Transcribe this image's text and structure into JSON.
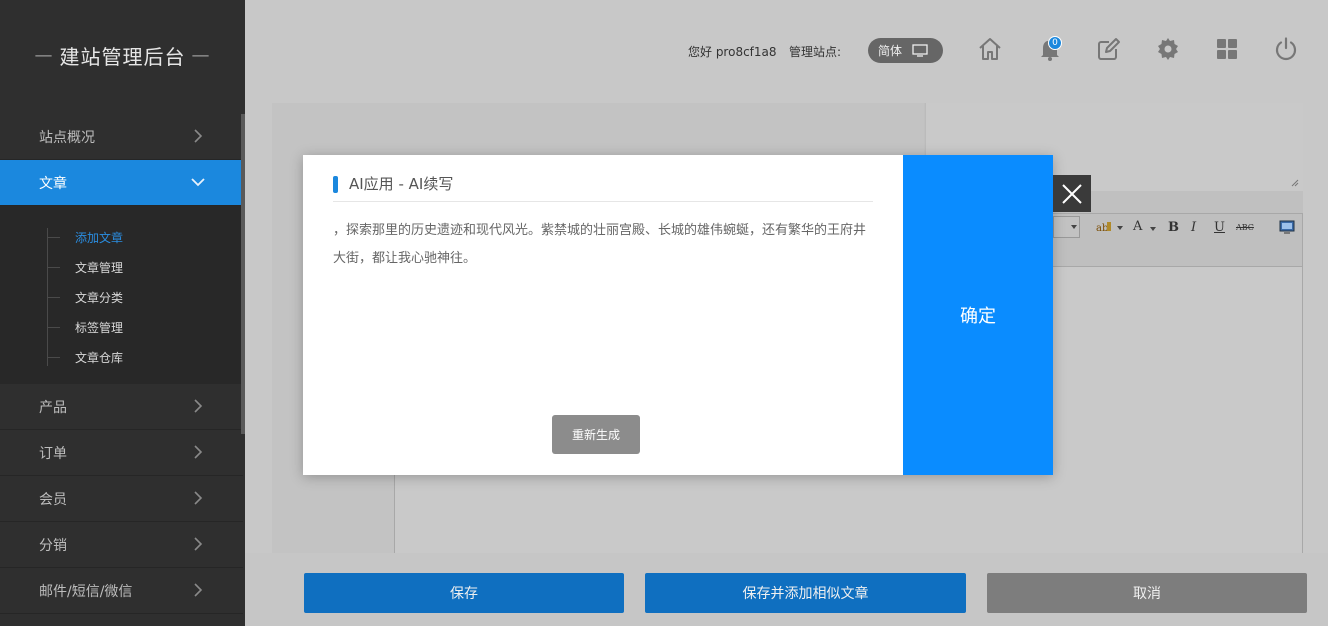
{
  "brand": {
    "title": "建站管理后台"
  },
  "sidebar": {
    "items": [
      {
        "label": "站点概况"
      },
      {
        "label": "文章"
      },
      {
        "label": "产品"
      },
      {
        "label": "订单"
      },
      {
        "label": "会员"
      },
      {
        "label": "分销"
      },
      {
        "label": "邮件/短信/微信"
      }
    ],
    "sub_items": [
      {
        "label": "添加文章"
      },
      {
        "label": "文章管理"
      },
      {
        "label": "文章分类"
      },
      {
        "label": "标签管理"
      },
      {
        "label": "文章仓库"
      }
    ]
  },
  "header": {
    "greeting": "您好 pro8cf1a8",
    "site_label": "管理站点:",
    "lang": "简体",
    "notification_count": "0",
    "icons": [
      "home-icon",
      "bell-icon",
      "edit-icon",
      "gear-icon",
      "grid-icon",
      "power-icon"
    ]
  },
  "editor_toolbar": {
    "bold": "B",
    "italic": "I",
    "underline": "U",
    "strike": "ABC",
    "font_color": "A"
  },
  "modal": {
    "title": "AI应用 - AI续写",
    "text": "，探索那里的历史遗迹和现代风光。紫禁城的壮丽宫殿、长城的雄伟蜿蜒，还有繁华的王府井大街，都让我心驰神往。",
    "regenerate_label": "重新生成",
    "confirm_label": "确定"
  },
  "actions": {
    "save": "保存",
    "save_similar": "保存并添加相似文章",
    "cancel": "取消"
  },
  "colors": {
    "accent": "#0a8cff",
    "sidebar_bg": "#2f2f2f",
    "active_menu": "#1b88de"
  }
}
